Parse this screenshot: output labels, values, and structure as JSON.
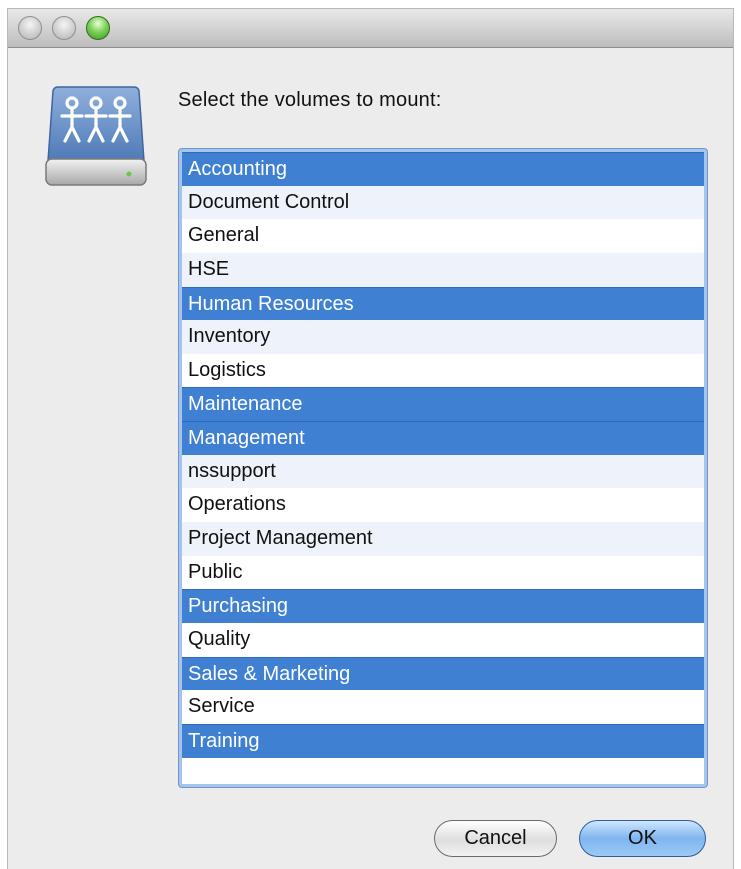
{
  "dialog": {
    "prompt": "Select the volumes to mount:",
    "icon": "network-drive-icon"
  },
  "volumes": {
    "items": [
      {
        "label": "Accounting",
        "selected": true
      },
      {
        "label": "Document Control",
        "selected": false
      },
      {
        "label": "General",
        "selected": false
      },
      {
        "label": "HSE",
        "selected": false
      },
      {
        "label": "Human Resources",
        "selected": true
      },
      {
        "label": "Inventory",
        "selected": false
      },
      {
        "label": "Logistics",
        "selected": false
      },
      {
        "label": "Maintenance",
        "selected": true
      },
      {
        "label": "Management",
        "selected": true
      },
      {
        "label": "nssupport",
        "selected": false
      },
      {
        "label": "Operations",
        "selected": false
      },
      {
        "label": "Project Management",
        "selected": false
      },
      {
        "label": "Public",
        "selected": false
      },
      {
        "label": "Purchasing",
        "selected": true
      },
      {
        "label": "Quality",
        "selected": false
      },
      {
        "label": "Sales & Marketing",
        "selected": true
      },
      {
        "label": "Service",
        "selected": false
      },
      {
        "label": "Training",
        "selected": true
      }
    ]
  },
  "buttons": {
    "cancel_label": "Cancel",
    "ok_label": "OK"
  },
  "colors": {
    "selection": "#3f80d3",
    "default_button": "#7fb5ef",
    "window_bg": "#ececec"
  }
}
